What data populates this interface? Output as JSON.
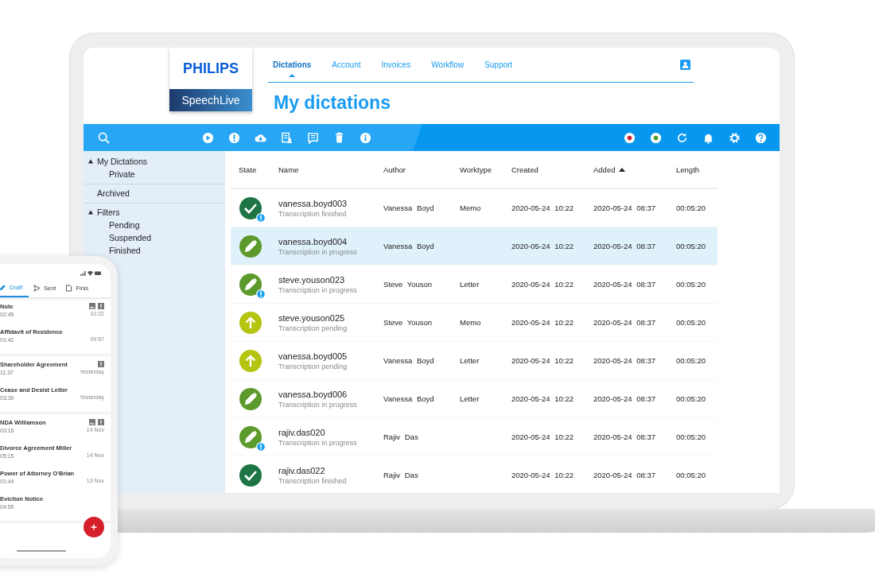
{
  "app": {
    "brand": "PHILIPS",
    "product": "SpeechLive"
  },
  "nav": [
    {
      "label": "Dictations",
      "selected": true
    },
    {
      "label": "Account",
      "selected": false
    },
    {
      "label": "Invoices",
      "selected": false
    },
    {
      "label": "Workflow",
      "selected": false
    },
    {
      "label": "Support",
      "selected": false
    }
  ],
  "page_title": "My dictations",
  "sidebar": {
    "groups": [
      {
        "label": "My Dictations",
        "expanded": true,
        "children": [
          {
            "label": "Private"
          }
        ]
      },
      {
        "label": "Archived"
      },
      {
        "label": "Filters",
        "expanded": true,
        "children": [
          {
            "label": "Pending"
          },
          {
            "label": "Suspended"
          },
          {
            "label": "Finished"
          }
        ]
      }
    ]
  },
  "table": {
    "columns": [
      {
        "label": "State",
        "sorted": false
      },
      {
        "label": "Name",
        "sorted": false
      },
      {
        "label": "Author",
        "sorted": false
      },
      {
        "label": "Worktype",
        "sorted": false
      },
      {
        "label": "Created",
        "sorted": false
      },
      {
        "label": "Added",
        "sorted": true
      },
      {
        "label": "Length",
        "sorted": false
      }
    ],
    "rows": [
      {
        "kind": "finished",
        "alert": true,
        "selected": false,
        "name": "vanessa.boyd003",
        "status": "Transcription finished",
        "author": "Vanessa Boyd",
        "worktype": "Memo",
        "created": "2020-05-24 10:22",
        "added": "2020-05-24 08:37",
        "length": "00:05:20"
      },
      {
        "kind": "in_progress",
        "alert": false,
        "selected": true,
        "name": "vanessa.boyd004",
        "status": "Transcription in progress",
        "author": "Vanessa Boyd",
        "created": "2020-05-24 10:22",
        "added": "2020-05-24 08:37",
        "length": "00:05:20"
      },
      {
        "kind": "in_progress",
        "alert": true,
        "selected": false,
        "name": "steve.youson023",
        "status": "Transcription in progress",
        "author": "Steve Youson",
        "worktype": "Letter",
        "created": "2020-05-24 10:22",
        "added": "2020-05-24 08:37",
        "length": "00:05:20"
      },
      {
        "kind": "pending",
        "alert": false,
        "selected": false,
        "name": "steve.youson025",
        "status": "Transcription pending",
        "author": "Steve Youson",
        "worktype": "Memo",
        "created": "2020-05-24 10:22",
        "added": "2020-05-24 08:37",
        "length": "00:05:20"
      },
      {
        "kind": "pending",
        "alert": false,
        "selected": false,
        "name": "vanessa.boyd005",
        "status": "Transcription pending",
        "author": "Vanessa Boyd",
        "worktype": "Letter",
        "created": "2020-05-24 10:22",
        "added": "2020-05-24 08:37",
        "length": "00:05:20"
      },
      {
        "kind": "in_progress",
        "alert": false,
        "selected": false,
        "name": "vanessa.boyd006",
        "status": "Transcription in progress",
        "author": "Vanessa Boyd",
        "worktype": "Letter",
        "created": "2020-05-24 10:22",
        "added": "2020-05-24 08:37",
        "length": "00:05:20"
      },
      {
        "kind": "in_progress",
        "alert": true,
        "selected": false,
        "name": "rajiv.das020",
        "status": "Transcription in progress",
        "author": "Rajiv Das",
        "created": "2020-05-24 10:22",
        "added": "2020-05-24 08:37",
        "length": "00:05:20"
      },
      {
        "kind": "finished",
        "alert": false,
        "selected": false,
        "name": "rajiv.das022",
        "status": "Transcription finished",
        "author": "Rajiv Das",
        "created": "2020-05-24 10:22",
        "added": "2020-05-24 08:37",
        "length": "00:05:20"
      }
    ]
  },
  "phone": {
    "tabs": [
      {
        "label": "Draft",
        "selected": true
      },
      {
        "label": "Sent",
        "selected": false
      },
      {
        "label": "Finis",
        "selected": false
      }
    ],
    "groups": [
      {
        "items": [
          {
            "title": "Note",
            "duration": "02:45",
            "time": "10:22",
            "image": true,
            "alert": true
          },
          {
            "title": "Affidavit of Residence",
            "duration": "01:42",
            "time": "09:57",
            "image": false,
            "alert": false
          }
        ]
      },
      {
        "items": [
          {
            "title": "Shareholder Agreement",
            "duration": "11:37",
            "time": "Yesterday",
            "image": false,
            "alert": true
          },
          {
            "title": "Cease and Desist Letter",
            "duration": "03:30",
            "time": "Yesterday",
            "image": false,
            "alert": false
          }
        ]
      },
      {
        "items": [
          {
            "title": "NDA Williamson",
            "duration": "03:16",
            "time": "14 Nov",
            "image": true,
            "alert": true
          },
          {
            "title": "Divorce Agreement Miller",
            "duration": "05:15",
            "time": "14 Nov",
            "image": false,
            "alert": false
          },
          {
            "title": "Power of Attorney O'Brian",
            "duration": "01:44",
            "time": "13 Nov",
            "image": false,
            "alert": false
          },
          {
            "title": "Eviction Notice",
            "duration": "04:55",
            "image": false,
            "alert": false
          }
        ]
      }
    ]
  }
}
